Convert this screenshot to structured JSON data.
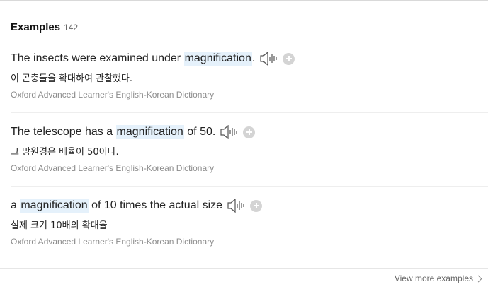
{
  "section": {
    "title": "Examples",
    "count": "142"
  },
  "examples": [
    {
      "before": "The insects were examined under ",
      "highlight": "magnification",
      "after": ".",
      "translation": "이 곤충들을 확대하여 관찰했다.",
      "source": "Oxford Advanced Learner's English-Korean Dictionary"
    },
    {
      "before": "The telescope has a ",
      "highlight": "magnification",
      "after": " of 50.",
      "translation": "그 망원경은 배율이 50이다.",
      "source": "Oxford Advanced Learner's English-Korean Dictionary"
    },
    {
      "before": "a ",
      "highlight": "magnification",
      "after": " of 10 times the actual size",
      "translation": "실제 크기 10배의 확대율",
      "source": "Oxford Advanced Learner's English-Korean Dictionary"
    }
  ],
  "footer": {
    "view_more_label": "View more examples"
  },
  "icons": {
    "speaker": "speaker-icon",
    "add": "plus-icon",
    "view_more": "chevron-right-icon"
  },
  "colors": {
    "highlight_bg": "#e5f1fb",
    "source_text": "#8c8c8c",
    "plus_button": "#d4d4d4"
  }
}
